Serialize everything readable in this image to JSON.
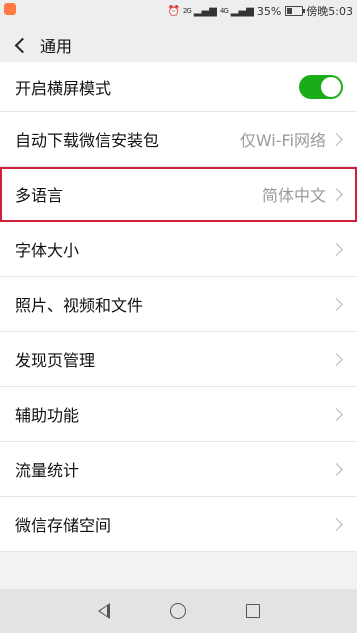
{
  "status_bar": {
    "alarm_icon": "alarm-icon",
    "network_1": "2G",
    "network_2": "4G",
    "battery_percent": "35%",
    "battery_level": 0.35,
    "time": "傍晚5:03"
  },
  "header": {
    "title": "通用"
  },
  "settings": {
    "items": [
      {
        "label": "开启横屏模式",
        "toggle_on": true
      },
      {
        "label": "自动下载微信安装包",
        "value": "仅Wi-Fi网络"
      },
      {
        "label": "多语言",
        "value": "简体中文"
      },
      {
        "label": "字体大小"
      },
      {
        "label": "照片、视频和文件"
      },
      {
        "label": "发现页管理"
      },
      {
        "label": "辅助功能"
      },
      {
        "label": "流量统计"
      },
      {
        "label": "微信存储空间"
      }
    ]
  },
  "colors": {
    "toggle_on": "#1aad19",
    "highlight_border": "#d0203a"
  }
}
